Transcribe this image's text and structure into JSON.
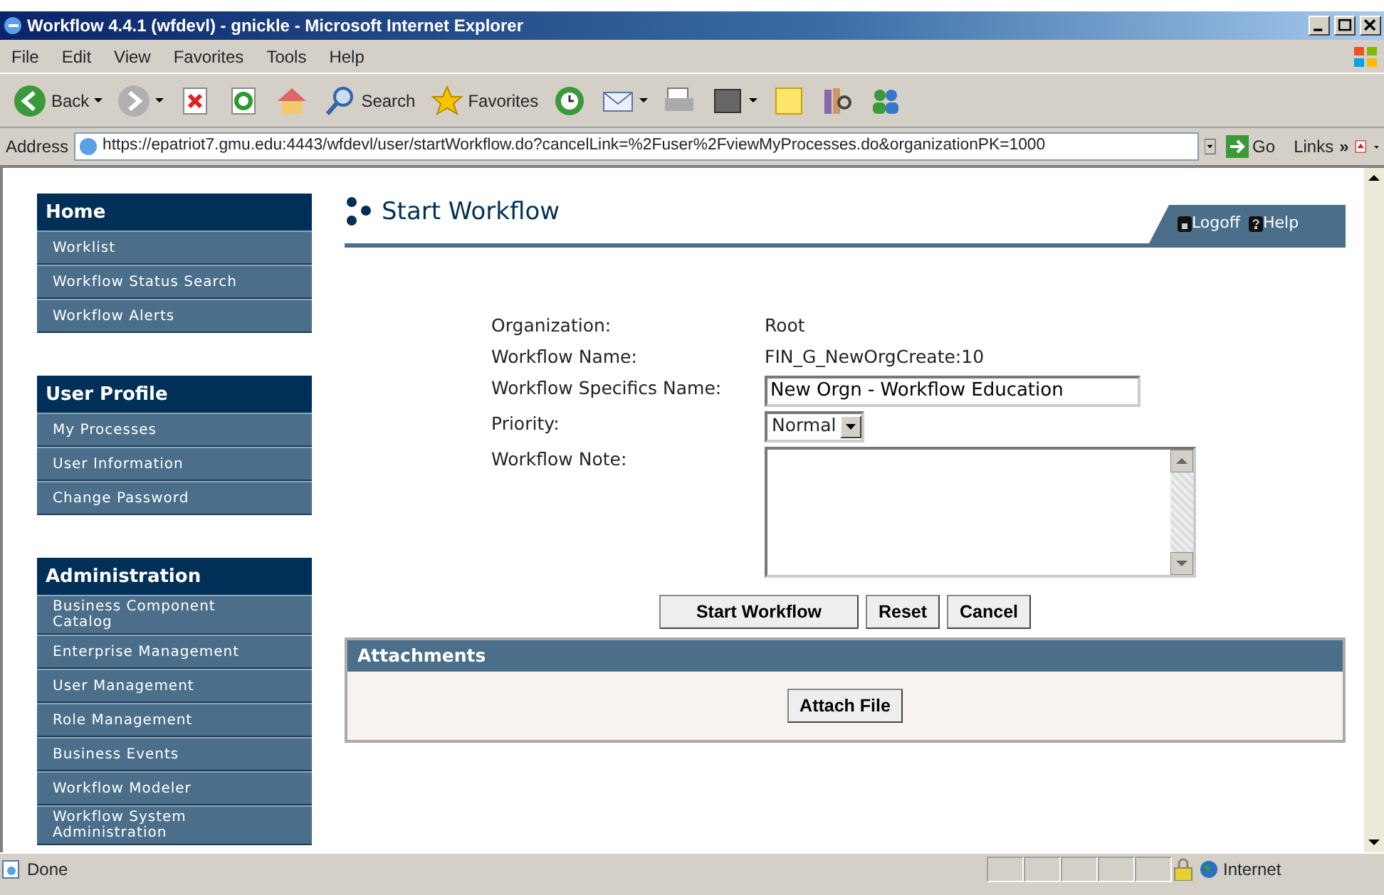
{
  "window": {
    "title": "Workflow 4.4.1 (wfdevl) - gnickle - Microsoft Internet Explorer"
  },
  "menu": [
    "File",
    "Edit",
    "View",
    "Favorites",
    "Tools",
    "Help"
  ],
  "toolbar": [
    {
      "kind": "back",
      "label": "Back"
    },
    {
      "kind": "forward"
    },
    {
      "kind": "stop"
    },
    {
      "kind": "refresh"
    },
    {
      "kind": "home"
    },
    {
      "kind": "search",
      "label": "Search"
    },
    {
      "kind": "favorites",
      "label": "Favorites"
    },
    {
      "kind": "history"
    },
    {
      "kind": "mail"
    },
    {
      "kind": "print"
    },
    {
      "kind": "edit"
    },
    {
      "kind": "note"
    },
    {
      "kind": "research"
    },
    {
      "kind": "messenger"
    }
  ],
  "address_bar": {
    "label": "Address",
    "url": "https://epatriot7.gmu.edu:4443/wfdevl/user/startWorkflow.do?cancelLink=%2Fuser%2FviewMyProcesses.do&organizationPK=1000",
    "go": "Go",
    "links": "Links",
    "links_more": "»"
  },
  "sidebar": [
    {
      "title": "Home",
      "items": [
        "Worklist",
        "Workflow Status Search",
        "Workflow Alerts"
      ]
    },
    {
      "title": "User Profile",
      "items": [
        "My Processes",
        "User Information",
        "Change Password"
      ]
    },
    {
      "title": "Administration",
      "items": [
        "Business Component Catalog",
        "Enterprise Management",
        "User Management",
        "Role Management",
        "Business Events",
        "Workflow Modeler",
        "Workflow System Administration"
      ]
    }
  ],
  "page": {
    "title": "Start Workflow",
    "header_links": [
      "Logoff",
      "Help"
    ],
    "fields": [
      {
        "kind": "text",
        "label": "Organization:",
        "value": "Root"
      },
      {
        "kind": "text",
        "label": "Workflow Name:",
        "value": "FIN_G_NewOrgCreate:10"
      },
      {
        "kind": "input",
        "label": "Workflow Specifics Name:",
        "value": "New Orgn - Workflow Education"
      },
      {
        "kind": "select",
        "label": "Priority:",
        "value": "Normal"
      },
      {
        "kind": "textarea",
        "label": "Workflow Note:"
      }
    ],
    "buttons": [
      "Start Workflow",
      "Reset",
      "Cancel"
    ],
    "attachments": {
      "title": "Attachments",
      "button": "Attach File"
    }
  },
  "status_bar": {
    "text": "Done",
    "zone": "Internet"
  }
}
